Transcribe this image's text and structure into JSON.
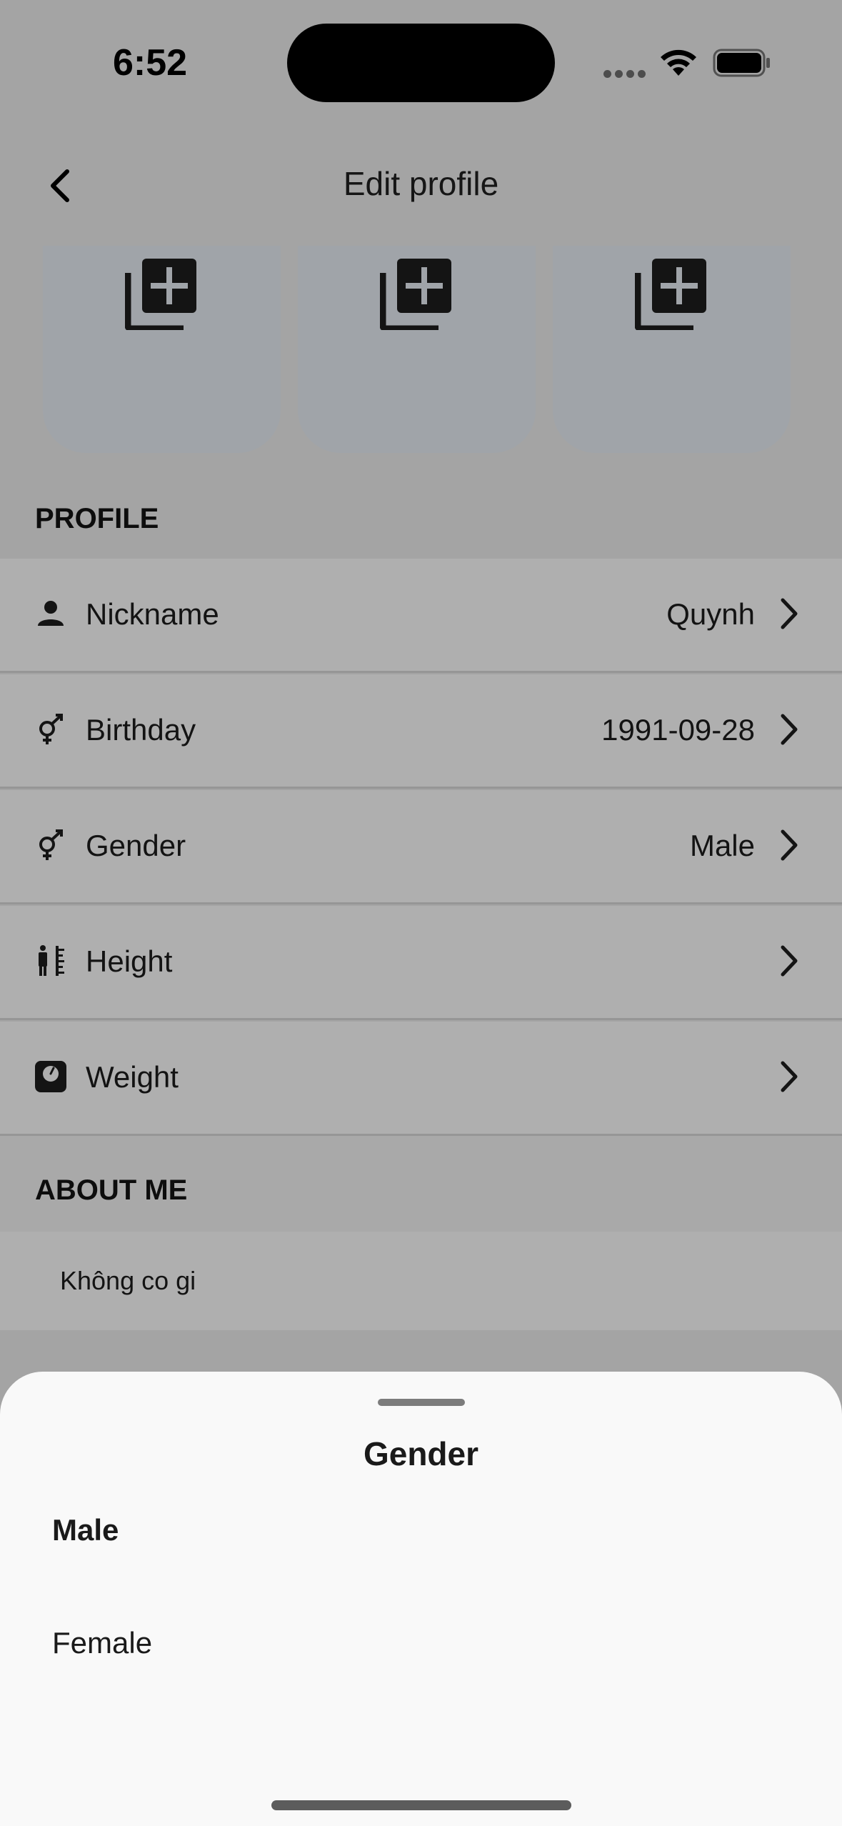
{
  "status_bar": {
    "time": "6:52"
  },
  "nav": {
    "title": "Edit profile"
  },
  "photos": [
    {
      "icon": "add-photo-icon"
    },
    {
      "icon": "add-photo-icon"
    },
    {
      "icon": "add-photo-icon"
    }
  ],
  "profile": {
    "header": "PROFILE",
    "rows": [
      {
        "label": "Nickname",
        "value": "Quynh",
        "icon": "person-icon"
      },
      {
        "label": "Birthday",
        "value": "1991-09-28",
        "icon": "gender-icon"
      },
      {
        "label": "Gender",
        "value": "Male",
        "icon": "gender-icon"
      },
      {
        "label": "Height",
        "value": "",
        "icon": "height-ruler-icon"
      },
      {
        "label": "Weight",
        "value": "",
        "icon": "scale-icon"
      }
    ]
  },
  "about": {
    "header": "ABOUT ME",
    "text": "Không co gi"
  },
  "sheet": {
    "title": "Gender",
    "options": [
      {
        "label": "Male",
        "selected": true
      },
      {
        "label": "Female",
        "selected": false
      }
    ]
  }
}
